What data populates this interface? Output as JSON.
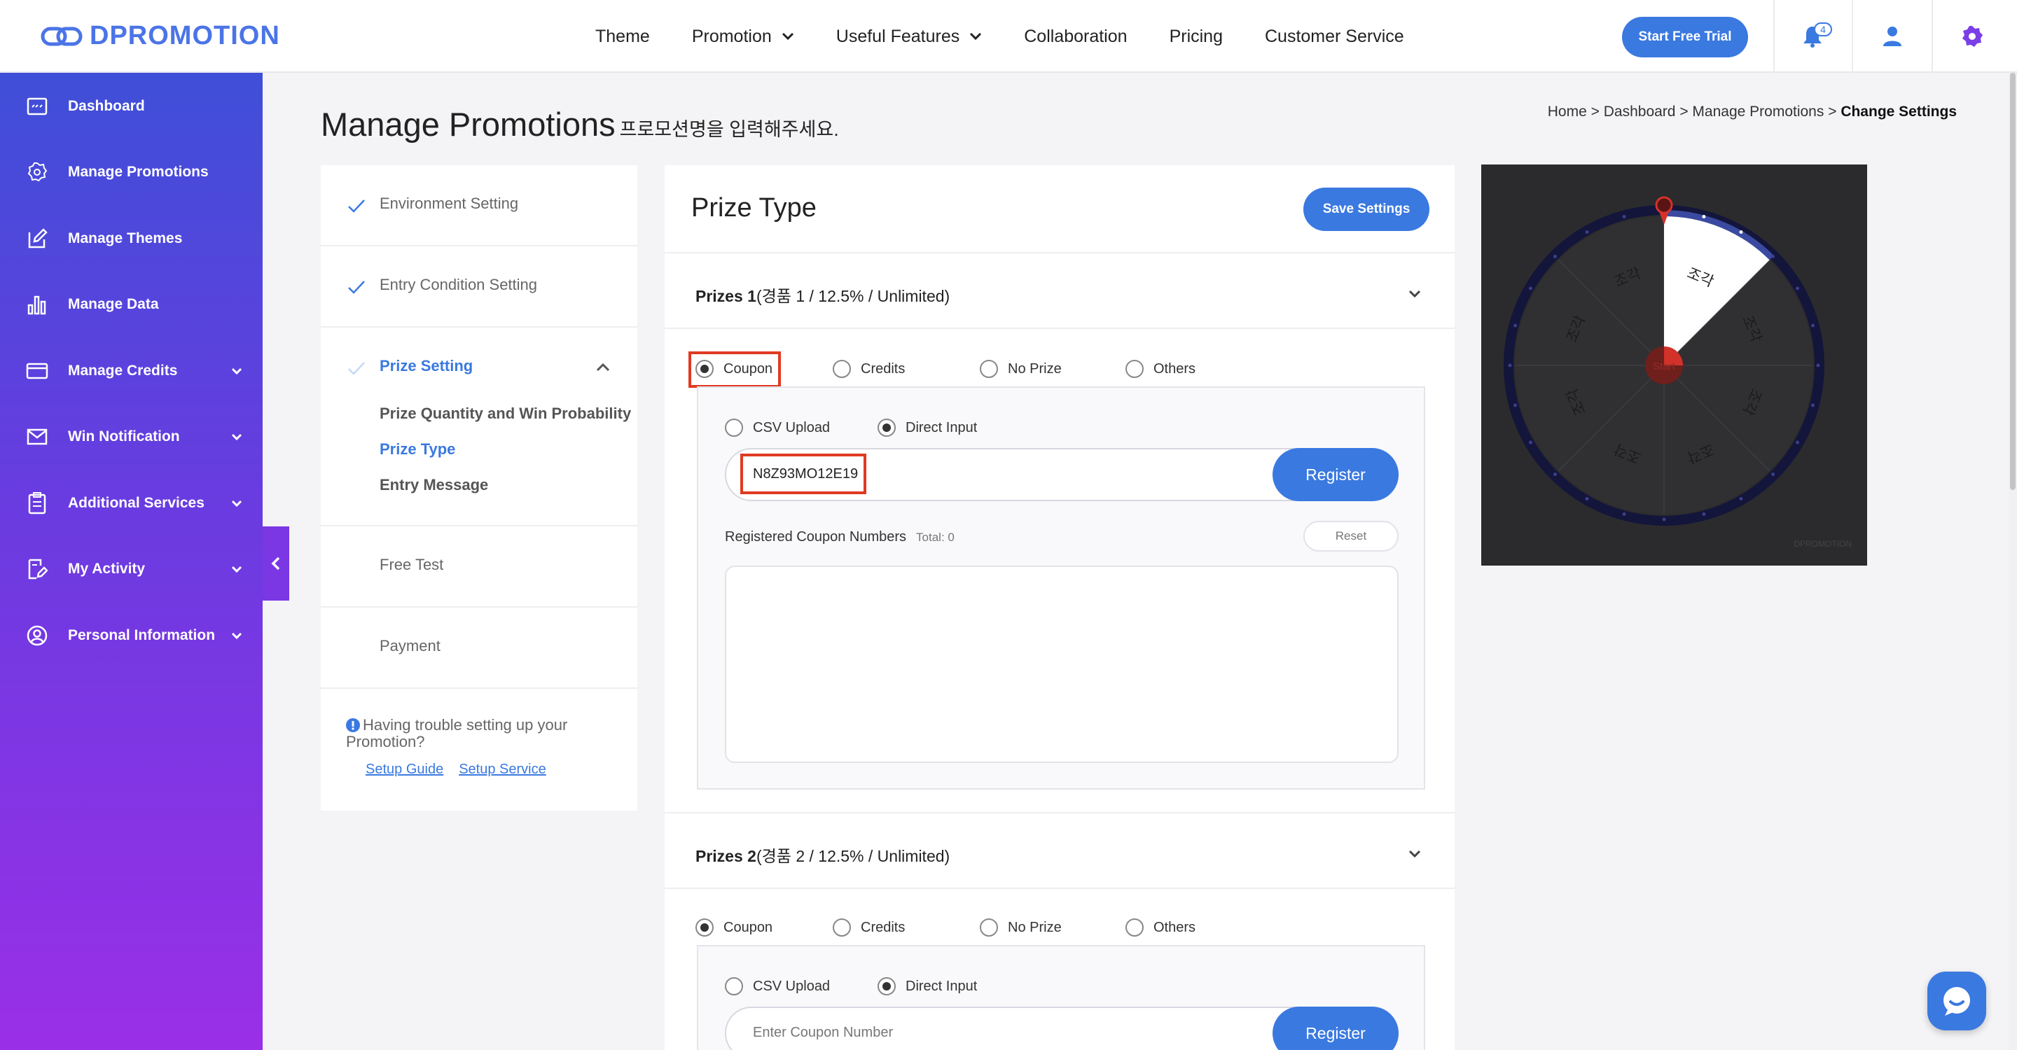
{
  "brand": {
    "name": "DPROMOTION",
    "accent": "#3a79e0"
  },
  "topnav": {
    "menu": [
      {
        "label": "Theme"
      },
      {
        "label": "Promotion"
      },
      {
        "label": "Useful Features"
      },
      {
        "label": "Collaboration"
      },
      {
        "label": "Pricing"
      },
      {
        "label": "Customer Service"
      }
    ],
    "trial_label": "Start Free Trial",
    "notification_count": "4"
  },
  "sidebar": {
    "items": [
      {
        "label": "Dashboard",
        "icon": "dashboard-icon"
      },
      {
        "label": "Manage Promotions",
        "icon": "gear-icon"
      },
      {
        "label": "Manage Themes",
        "icon": "edit-icon"
      },
      {
        "label": "Manage Data",
        "icon": "bar-chart-icon"
      },
      {
        "label": "Manage Credits",
        "icon": "card-icon"
      },
      {
        "label": "Win Notification",
        "icon": "mail-icon"
      },
      {
        "label": "Additional Services",
        "icon": "clipboard-icon"
      },
      {
        "label": "My Activity",
        "icon": "note-edit-icon"
      },
      {
        "label": "Personal Information",
        "icon": "user-circle-icon"
      }
    ]
  },
  "page": {
    "title": "Manage Promotions",
    "subtitle": "프로모션명을 입력해주세요.",
    "breadcrumb": {
      "home": "Home",
      "sep": ">",
      "dashboard": "Dashboard",
      "manage": "Manage Promotions",
      "current": "Change Settings"
    }
  },
  "steps": {
    "env": "Environment Setting",
    "entry": "Entry Condition Setting",
    "prize": "Prize Setting",
    "sub": [
      "Prize Quantity and Win Probability",
      "Prize Type",
      "Entry Message"
    ],
    "free_test": "Free Test",
    "payment": "Payment",
    "help": "Having trouble setting up your Promotion?",
    "setup_guide": "Setup Guide",
    "setup_service": "Setup Service"
  },
  "main": {
    "title": "Prize Type",
    "save_label": "Save Settings",
    "options": {
      "coupon": "Coupon",
      "credits": "Credits",
      "no_prize": "No Prize",
      "others": "Others",
      "csv": "CSV Upload",
      "direct": "Direct Input"
    },
    "register_label": "Register",
    "registered_label": "Registered Coupon Numbers",
    "total_label": "Total: 0",
    "reset_label": "Reset",
    "prizes": [
      {
        "name": "Prizes 1",
        "detail": "(경품 1 / 12.5% / Unlimited)",
        "selected_type": "Coupon",
        "input_method": "Direct Input",
        "coupon_value": "N8Z93MO12E19"
      },
      {
        "name": "Prizes 2",
        "detail": "(경품 2 / 12.5% / Unlimited)",
        "selected_type": "Coupon",
        "input_method": "Direct Input",
        "coupon_placeholder": "Enter Coupon Number"
      }
    ]
  },
  "preview": {
    "wheel_segments": [
      "조각",
      "조각",
      "조각",
      "조각",
      "조각",
      "조각",
      "조각",
      "조각"
    ],
    "center_label": "Start",
    "brand": "DPROMOTION"
  }
}
